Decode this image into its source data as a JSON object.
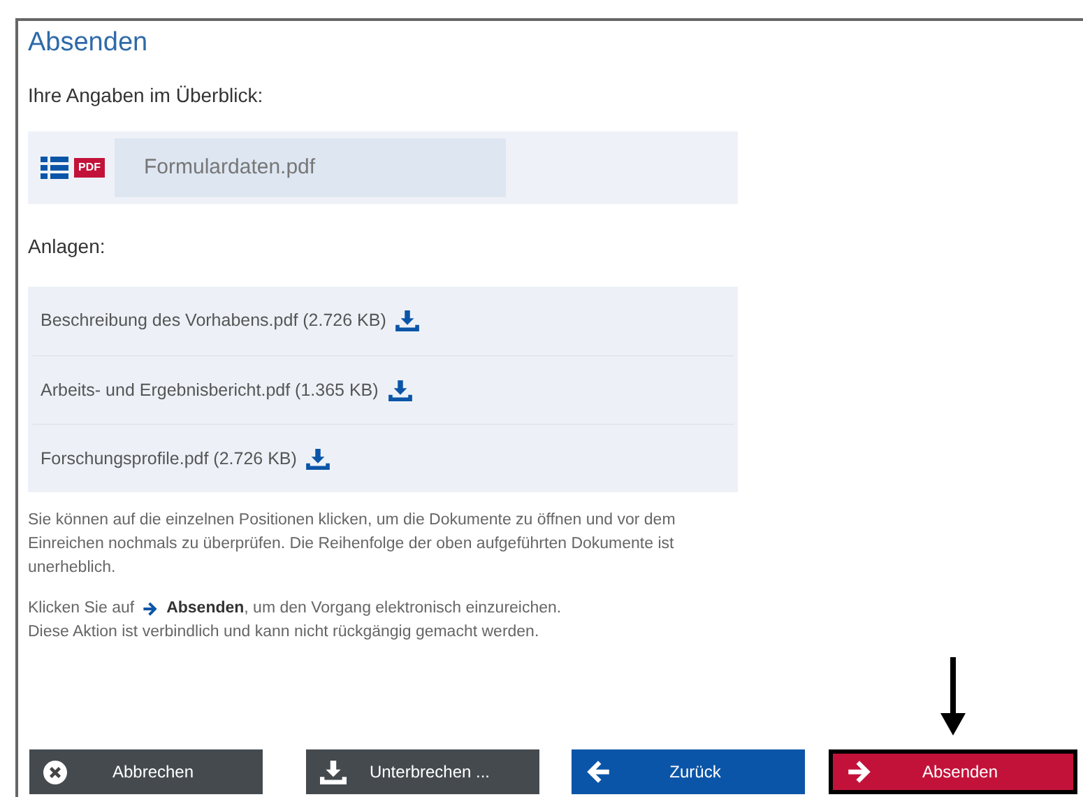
{
  "title": "Absenden",
  "overview_label": "Ihre Angaben im Überblick:",
  "form_file": {
    "badge": "PDF",
    "name": "Formulardaten.pdf"
  },
  "attachments_label": "Anlagen:",
  "attachments": [
    {
      "name": "Beschreibung des Vorhabens.pdf (2.726 KB)"
    },
    {
      "name": "Arbeits- und Ergebnisbericht.pdf (1.365 KB)"
    },
    {
      "name": "Forschungsprofile.pdf (2.726 KB)"
    }
  ],
  "hint": "Sie können auf die einzelnen Positionen klicken, um die Dokumente zu öffnen und vor dem Einreichen nochmals zu überprüfen. Die Reihenfolge der oben aufgeführten Dokumente ist unerheblich.",
  "instruction": {
    "prefix": "Klicken Sie auf",
    "rest": "**Absenden**, um den Vorgang elektronisch einzureichen."
  },
  "note": "Diese Aktion ist verbindlich und kann nicht rückgängig gemacht werden.",
  "buttons": [
    {
      "label": "Abbrechen",
      "kind": "cancel",
      "highlighted": false
    },
    {
      "label": "Unterbrechen ...",
      "kind": "pause",
      "highlighted": false
    },
    {
      "label": "Zurück",
      "kind": "back",
      "highlighted": false
    },
    {
      "label": "Absenden",
      "kind": "submit",
      "highlighted": true
    }
  ]
}
